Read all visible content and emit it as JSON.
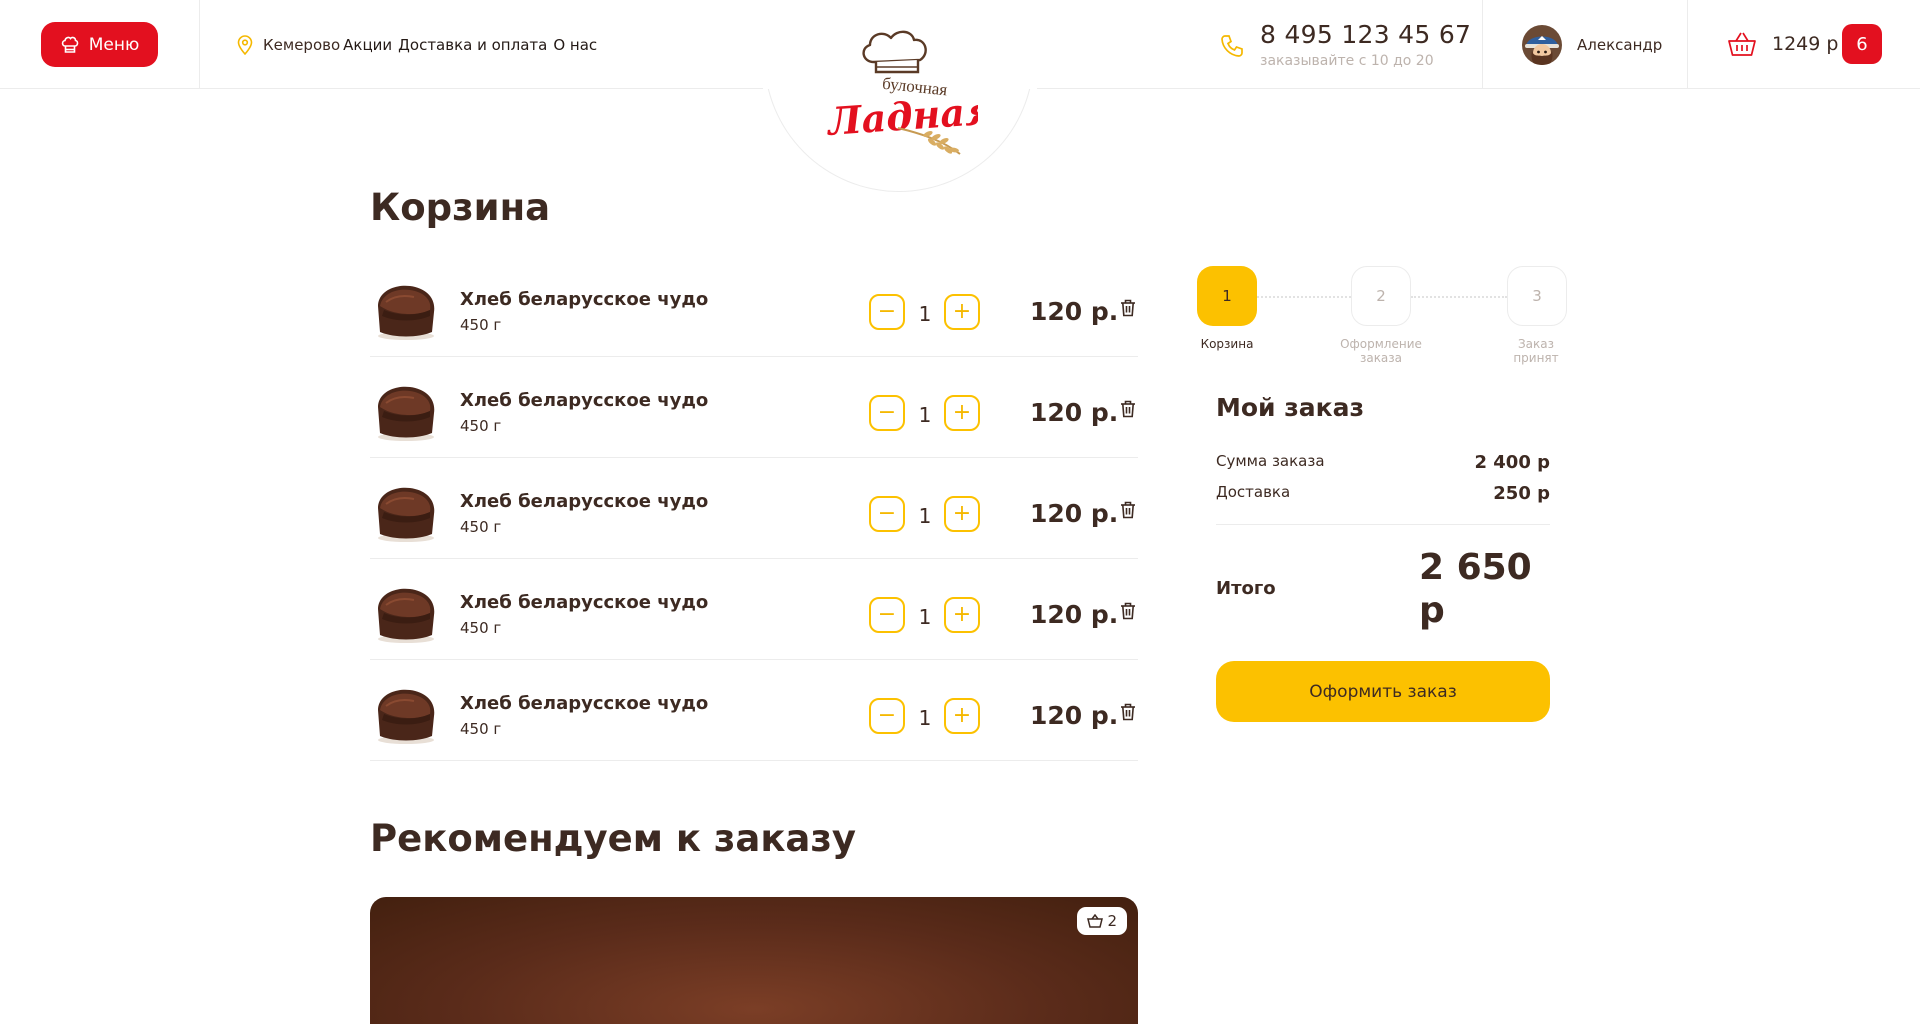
{
  "header": {
    "menu_label": "Меню",
    "city": "Кемерово",
    "nav": [
      "Акции",
      "Доставка и оплата",
      "О нас"
    ],
    "logo_text_top": "булочная",
    "logo_text_main": "Ладная",
    "phone": "8 495 123 45 67",
    "hours": "заказывайте с 10 до 20",
    "user_name": "Александр",
    "basket_total": "1249 р",
    "basket_count": "6"
  },
  "cart": {
    "title": "Корзина",
    "items": [
      {
        "name": "Хлеб беларусское чудо",
        "weight": "450 г",
        "qty": "1",
        "price": "120 р."
      },
      {
        "name": "Хлеб беларусское чудо",
        "weight": "450 г",
        "qty": "1",
        "price": "120 р."
      },
      {
        "name": "Хлеб беларусское чудо",
        "weight": "450 г",
        "qty": "1",
        "price": "120 р."
      },
      {
        "name": "Хлеб беларусское чудо",
        "weight": "450 г",
        "qty": "1",
        "price": "120 р."
      },
      {
        "name": "Хлеб беларусское чудо",
        "weight": "450 г",
        "qty": "1",
        "price": "120 р."
      }
    ],
    "minus_symbol": "−",
    "plus_symbol": "+"
  },
  "steps": [
    {
      "num": "1",
      "label": "Корзина",
      "active": true
    },
    {
      "num": "2",
      "label": "Оформление заказа",
      "active": false
    },
    {
      "num": "3",
      "label": "Заказ принят",
      "active": false
    }
  ],
  "summary": {
    "title": "Мой заказ",
    "order_sum_label": "Сумма заказа",
    "order_sum_value": "2 400 р",
    "delivery_label": "Доставка",
    "delivery_value": "250 р",
    "total_label": "Итого",
    "total_value": "2 650 р",
    "checkout_label": "Оформить заказ"
  },
  "recommend": {
    "title": "Рекомендуем к заказу",
    "badge_count": "2"
  },
  "colors": {
    "accent_red": "#e3101f",
    "accent_yellow": "#fcc100",
    "text_dark": "#3d2a22",
    "text_muted": "#bdb3ad"
  },
  "icons": [
    "chef-hat-icon",
    "map-pin-icon",
    "phone-icon",
    "basket-icon",
    "trash-icon",
    "minus-icon",
    "plus-icon"
  ]
}
